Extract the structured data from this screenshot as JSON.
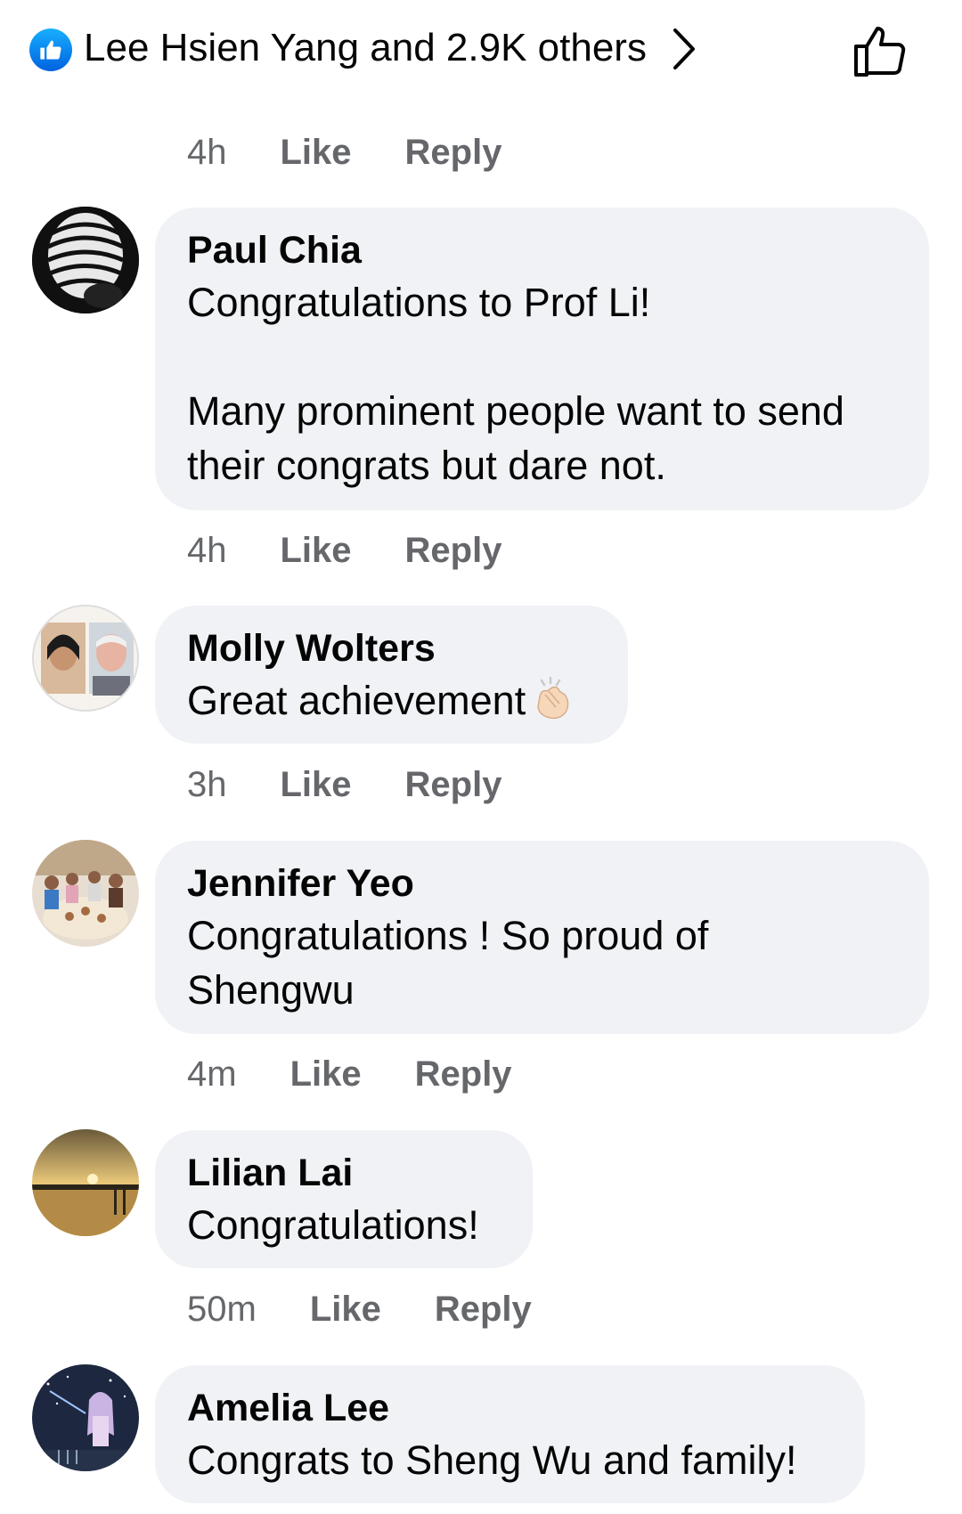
{
  "reactions": {
    "summary": "Lee Hsien Yang and 2.9K others",
    "reaction_icon": "like-reaction-icon",
    "accent_color": "#1877f2"
  },
  "top_meta": {
    "time": "4h",
    "like_label": "Like",
    "reply_label": "Reply"
  },
  "comments": [
    {
      "author": "Paul Chia",
      "lines": [
        "Congratulations to Prof Li!",
        "",
        "Many prominent people want to send their congrats but dare not."
      ],
      "time": "4h",
      "like_label": "Like",
      "reply_label": "Reply"
    },
    {
      "author": "Molly Wolters",
      "lines": [
        "Great achievement"
      ],
      "emoji": "clapping-hands-icon",
      "time": "3h",
      "like_label": "Like",
      "reply_label": "Reply"
    },
    {
      "author": "Jennifer Yeo",
      "lines": [
        "Congratulations ! So proud of Shengwu"
      ],
      "time": "4m",
      "like_label": "Like",
      "reply_label": "Reply"
    },
    {
      "author": "Lilian Lai",
      "lines": [
        "Congratulations!"
      ],
      "time": "50m",
      "like_label": "Like",
      "reply_label": "Reply"
    },
    {
      "author": "Amelia Lee",
      "lines": [
        "Congrats to Sheng Wu and family!"
      ]
    }
  ],
  "colors": {
    "bubble": "#f0f2f5",
    "meta_text": "#65676b",
    "text": "#050505"
  }
}
